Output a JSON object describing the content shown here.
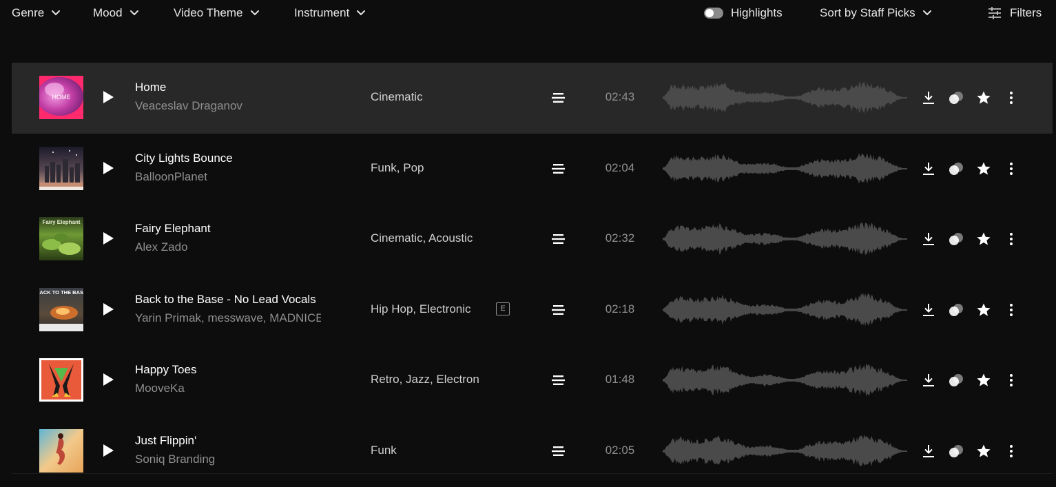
{
  "toolbar": {
    "genre_label": "Genre",
    "mood_label": "Mood",
    "video_theme_label": "Video Theme",
    "instrument_label": "Instrument",
    "highlights_label": "Highlights",
    "highlights_on": false,
    "sort_label": "Sort by Staff Picks",
    "filters_label": "Filters"
  },
  "colors": {
    "background": "#0d0d0d",
    "active_row": "#282828",
    "primary_text": "#ffffff",
    "secondary_text": "#8f8f8f",
    "waveform": "#4a4a4a"
  },
  "tracks": [
    {
      "title": "Home",
      "artist": "Veaceslav Draganov",
      "genres": "Cinematic",
      "explicit": false,
      "duration": "02:43",
      "cover_text": "HOME",
      "active": true
    },
    {
      "title": "City Lights Bounce",
      "artist": "BalloonPlanet",
      "genres": "Funk, Pop",
      "explicit": false,
      "duration": "02:04",
      "active": false
    },
    {
      "title": "Fairy Elephant",
      "artist": "Alex Zado",
      "genres": "Cinematic, Acoustic",
      "explicit": false,
      "duration": "02:32",
      "cover_text": "Fairy Elephant",
      "active": false
    },
    {
      "title": "Back to the Base - No Lead Vocals",
      "artist": "Yarin Primak, messwave, MADNICE",
      "genres": "Hip Hop, Electronic",
      "explicit": true,
      "explicit_label": "E",
      "duration": "02:18",
      "cover_text": "BACK TO THE BASE",
      "active": false
    },
    {
      "title": "Happy Toes",
      "artist": "MooveKa",
      "genres": "Retro, Jazz, Electronic",
      "explicit": false,
      "duration": "01:48",
      "active": false
    },
    {
      "title": "Just Flippin'",
      "artist": "Soniq Branding",
      "genres": "Funk",
      "explicit": false,
      "duration": "02:05",
      "active": false
    }
  ]
}
